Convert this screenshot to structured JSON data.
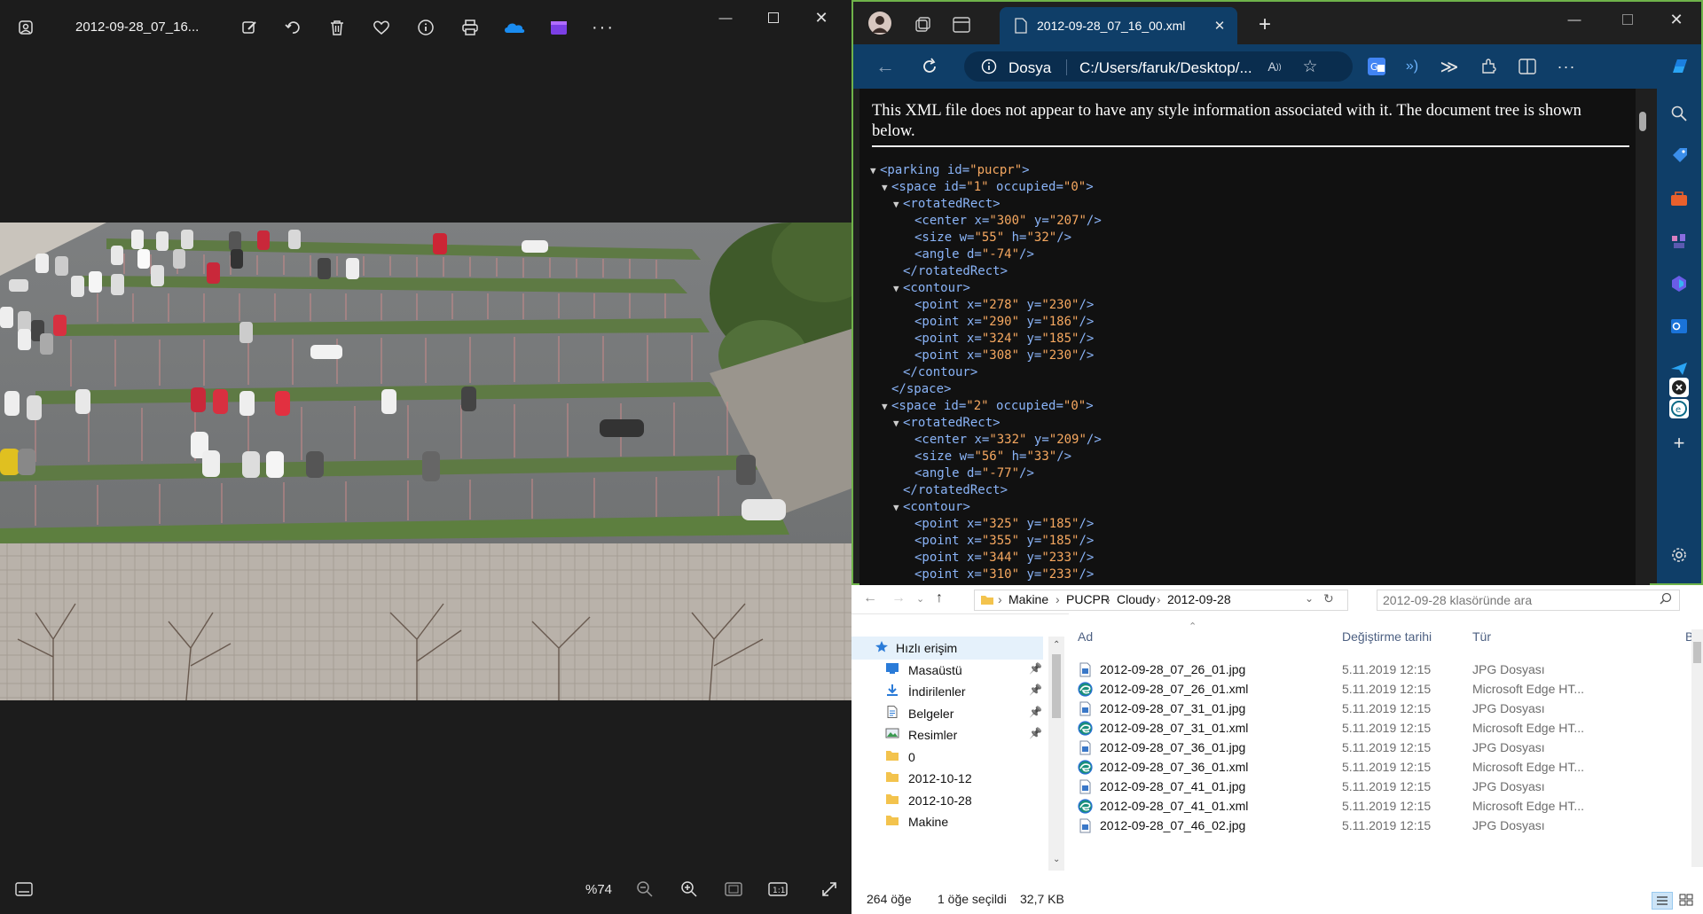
{
  "photos": {
    "title": "2012-09-28_07_16...",
    "zoom": "%74",
    "toolbar_icons": [
      "edit-icon",
      "rotate-icon",
      "delete-icon",
      "favorite-icon",
      "info-icon",
      "print-icon",
      "onedrive-icon",
      "clipchamp-icon",
      "more-icon"
    ],
    "bottom_icons": [
      "filmstrip-icon",
      "zoom-out-icon",
      "zoom-in-icon",
      "fit-icon",
      "actual-size-icon",
      "fullscreen-icon"
    ]
  },
  "edge": {
    "tab_title": "2012-09-28_07_16_00.xml",
    "address_scheme": "Dosya",
    "address_url": "C:/Users/faruk/Desktop/...",
    "xml_message": "This XML file does not appear to have any style information associated with it. The document tree is shown below.",
    "xml_lines": [
      {
        "indent": 0,
        "tri": "▼",
        "open": "parking",
        "attrs": [
          [
            "id",
            "pucpr"
          ]
        ],
        "close": ">"
      },
      {
        "indent": 1,
        "tri": "▼",
        "open": "space",
        "attrs": [
          [
            "id",
            "1"
          ],
          [
            "occupied",
            "0"
          ]
        ],
        "close": ">"
      },
      {
        "indent": 2,
        "tri": "▼",
        "open": "rotatedRect",
        "attrs": [],
        "close": ">"
      },
      {
        "indent": 3,
        "tri": "",
        "open": "center",
        "attrs": [
          [
            "x",
            "300"
          ],
          [
            "y",
            "207"
          ]
        ],
        "close": "/>"
      },
      {
        "indent": 3,
        "tri": "",
        "open": "size",
        "attrs": [
          [
            "w",
            "55"
          ],
          [
            "h",
            "32"
          ]
        ],
        "close": "/>"
      },
      {
        "indent": 3,
        "tri": "",
        "open": "angle",
        "attrs": [
          [
            "d",
            "-74"
          ]
        ],
        "close": "/>"
      },
      {
        "indent": 2,
        "tri": "",
        "end": "rotatedRect"
      },
      {
        "indent": 2,
        "tri": "▼",
        "open": "contour",
        "attrs": [],
        "close": ">"
      },
      {
        "indent": 3,
        "tri": "",
        "open": "point",
        "attrs": [
          [
            "x",
            "278"
          ],
          [
            "y",
            "230"
          ]
        ],
        "close": "/>"
      },
      {
        "indent": 3,
        "tri": "",
        "open": "point",
        "attrs": [
          [
            "x",
            "290"
          ],
          [
            "y",
            "186"
          ]
        ],
        "close": "/>"
      },
      {
        "indent": 3,
        "tri": "",
        "open": "point",
        "attrs": [
          [
            "x",
            "324"
          ],
          [
            "y",
            "185"
          ]
        ],
        "close": "/>"
      },
      {
        "indent": 3,
        "tri": "",
        "open": "point",
        "attrs": [
          [
            "x",
            "308"
          ],
          [
            "y",
            "230"
          ]
        ],
        "close": "/>"
      },
      {
        "indent": 2,
        "tri": "",
        "end": "contour"
      },
      {
        "indent": 1,
        "tri": "",
        "end": "space"
      },
      {
        "indent": 1,
        "tri": "▼",
        "open": "space",
        "attrs": [
          [
            "id",
            "2"
          ],
          [
            "occupied",
            "0"
          ]
        ],
        "close": ">"
      },
      {
        "indent": 2,
        "tri": "▼",
        "open": "rotatedRect",
        "attrs": [],
        "close": ">"
      },
      {
        "indent": 3,
        "tri": "",
        "open": "center",
        "attrs": [
          [
            "x",
            "332"
          ],
          [
            "y",
            "209"
          ]
        ],
        "close": "/>"
      },
      {
        "indent": 3,
        "tri": "",
        "open": "size",
        "attrs": [
          [
            "w",
            "56"
          ],
          [
            "h",
            "33"
          ]
        ],
        "close": "/>"
      },
      {
        "indent": 3,
        "tri": "",
        "open": "angle",
        "attrs": [
          [
            "d",
            "-77"
          ]
        ],
        "close": "/>"
      },
      {
        "indent": 2,
        "tri": "",
        "end": "rotatedRect"
      },
      {
        "indent": 2,
        "tri": "▼",
        "open": "contour",
        "attrs": [],
        "close": ">"
      },
      {
        "indent": 3,
        "tri": "",
        "open": "point",
        "attrs": [
          [
            "x",
            "325"
          ],
          [
            "y",
            "185"
          ]
        ],
        "close": "/>"
      },
      {
        "indent": 3,
        "tri": "",
        "open": "point",
        "attrs": [
          [
            "x",
            "355"
          ],
          [
            "y",
            "185"
          ]
        ],
        "close": "/>"
      },
      {
        "indent": 3,
        "tri": "",
        "open": "point",
        "attrs": [
          [
            "x",
            "344"
          ],
          [
            "y",
            "233"
          ]
        ],
        "close": "/>"
      },
      {
        "indent": 3,
        "tri": "",
        "open": "point",
        "attrs": [
          [
            "x",
            "310"
          ],
          [
            "y",
            "233"
          ]
        ],
        "close": "/>"
      }
    ]
  },
  "explorer": {
    "breadcrumb": [
      "Makine",
      "PUCPR",
      "Cloudy",
      "2012-09-28"
    ],
    "search_placeholder": "2012-09-28 klasöründe ara",
    "columns": {
      "name": "Ad",
      "date": "Değiştirme tarihi",
      "type": "Tür",
      "size": "Bo"
    },
    "tree": [
      {
        "label": "Hızlı erişim",
        "icon": "star",
        "pinned": false,
        "selected": true
      },
      {
        "label": "Masaüstü",
        "icon": "desktop",
        "pinned": true
      },
      {
        "label": "İndirilenler",
        "icon": "download",
        "pinned": true
      },
      {
        "label": "Belgeler",
        "icon": "document",
        "pinned": true
      },
      {
        "label": "Resimler",
        "icon": "pictures",
        "pinned": true
      },
      {
        "label": "0",
        "icon": "folder",
        "pinned": false
      },
      {
        "label": "2012-10-12",
        "icon": "folder",
        "pinned": false
      },
      {
        "label": "2012-10-28",
        "icon": "folder",
        "pinned": false
      },
      {
        "label": "Makine",
        "icon": "folder",
        "pinned": false
      }
    ],
    "files": [
      {
        "name": "2012-09-28_07_26_01.jpg",
        "date": "5.11.2019 12:15",
        "type": "JPG Dosyası",
        "kind": "jpg"
      },
      {
        "name": "2012-09-28_07_26_01.xml",
        "date": "5.11.2019 12:15",
        "type": "Microsoft Edge HT...",
        "kind": "xml"
      },
      {
        "name": "2012-09-28_07_31_01.jpg",
        "date": "5.11.2019 12:15",
        "type": "JPG Dosyası",
        "kind": "jpg"
      },
      {
        "name": "2012-09-28_07_31_01.xml",
        "date": "5.11.2019 12:15",
        "type": "Microsoft Edge HT...",
        "kind": "xml"
      },
      {
        "name": "2012-09-28_07_36_01.jpg",
        "date": "5.11.2019 12:15",
        "type": "JPG Dosyası",
        "kind": "jpg"
      },
      {
        "name": "2012-09-28_07_36_01.xml",
        "date": "5.11.2019 12:15",
        "type": "Microsoft Edge HT...",
        "kind": "xml"
      },
      {
        "name": "2012-09-28_07_41_01.jpg",
        "date": "5.11.2019 12:15",
        "type": "JPG Dosyası",
        "kind": "jpg"
      },
      {
        "name": "2012-09-28_07_41_01.xml",
        "date": "5.11.2019 12:15",
        "type": "Microsoft Edge HT...",
        "kind": "xml"
      },
      {
        "name": "2012-09-28_07_46_02.jpg",
        "date": "5.11.2019 12:15",
        "type": "JPG Dosyası",
        "kind": "jpg"
      }
    ],
    "status": {
      "count": "264 öğe",
      "selected": "1 öğe seçildi",
      "size": "32,7 KB"
    }
  },
  "colors": {
    "edge_accent": "#0f3e68",
    "window_border": "#6fb34a",
    "xml_tag": "#8ab4f8",
    "xml_value": "#f6a860"
  }
}
